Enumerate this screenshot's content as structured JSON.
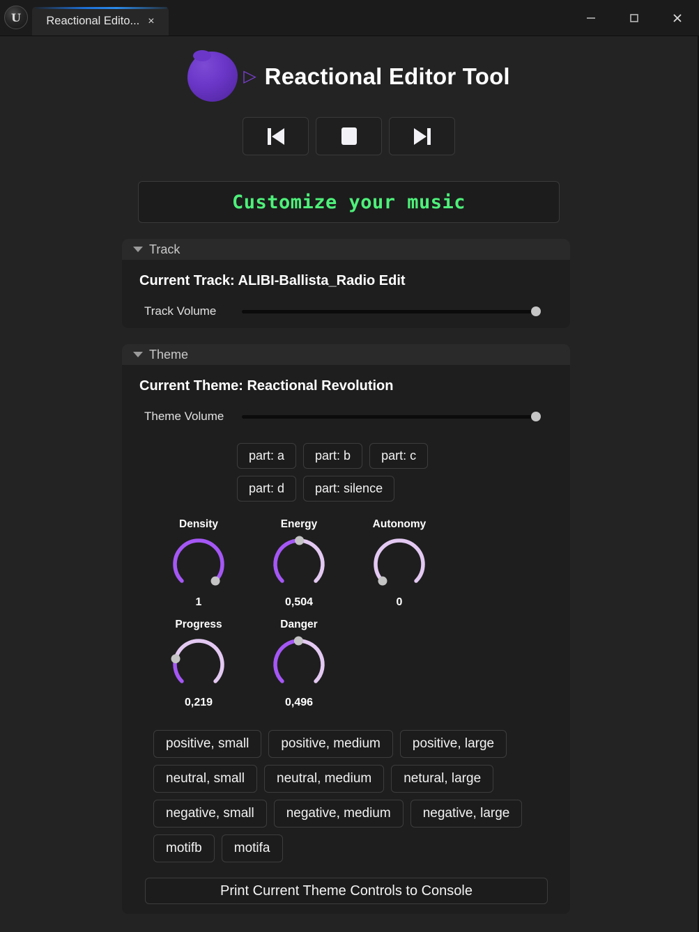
{
  "window": {
    "tab_title": "Reactional Edito...",
    "close_tab_label": "×",
    "minimize_label": "minimize-icon",
    "maximize_label": "maximize-icon",
    "close_label": "close-icon",
    "accent_color": "#1d6fd4"
  },
  "header": {
    "app_title": "Reactional Editor Tool",
    "logo_name": "reactional-blob-logo",
    "play_glyph": "▷",
    "brand_purple": "#6b37c9"
  },
  "transport": {
    "prev_label": "previous-track",
    "stop_label": "stop",
    "next_label": "next-track"
  },
  "banner": {
    "label": "Customize your music",
    "color": "#4ef07a"
  },
  "track_panel": {
    "section_title": "Track",
    "current_track": "Current Track: ALIBI-Ballista_Radio Edit",
    "volume_label": "Track Volume",
    "volume_value": 1
  },
  "theme_panel": {
    "section_title": "Theme",
    "current_theme": "Current Theme: Reactional Revolution",
    "volume_label": "Theme Volume",
    "volume_value": 1,
    "parts": [
      {
        "label": "part: a"
      },
      {
        "label": "part: b"
      },
      {
        "label": "part: c"
      },
      {
        "label": "part: d"
      },
      {
        "label": "part: silence"
      }
    ],
    "knobs": [
      {
        "name": "Density",
        "value": 1,
        "display": "1"
      },
      {
        "name": "Energy",
        "value": 0.504,
        "display": "0,504"
      },
      {
        "name": "Autonomy",
        "value": 0,
        "display": "0"
      },
      {
        "name": "Progress",
        "value": 0.219,
        "display": "0,219"
      },
      {
        "name": "Danger",
        "value": 0.496,
        "display": "0,496"
      }
    ],
    "knob_colors": {
      "active": "#a557f5",
      "inactive": "#e3c9f2",
      "handle": "#c4c4c4"
    },
    "stingers": [
      {
        "label": "positive, small"
      },
      {
        "label": "positive, medium"
      },
      {
        "label": "positive, large"
      },
      {
        "label": "neutral, small"
      },
      {
        "label": "neutral, medium"
      },
      {
        "label": "netural, large"
      },
      {
        "label": "negative, small"
      },
      {
        "label": "negative, medium"
      },
      {
        "label": "negative, large"
      },
      {
        "label": "motifb"
      },
      {
        "label": "motifa"
      }
    ],
    "print_button": "Print Current Theme Controls to Console"
  }
}
